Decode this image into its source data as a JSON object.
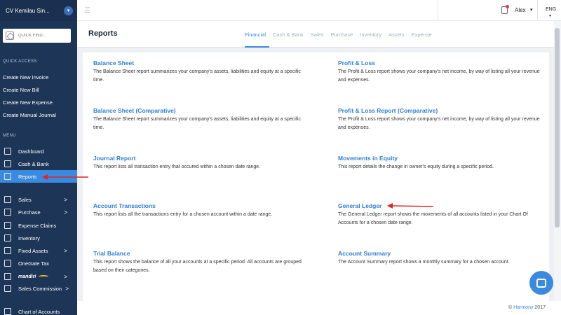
{
  "company": "CV Kemilau Sin...",
  "quick_find_placeholder": "QUICK FIND...",
  "quick_access_label": "QUICK ACCESS",
  "quick_access": [
    "Create New Invoice",
    "Create New Bill",
    "Create New Expense",
    "Create Manual Journal"
  ],
  "menu_label": "MENU",
  "menu": [
    {
      "label": "Dashboard",
      "icon": "dashboard-icon"
    },
    {
      "label": "Cash & Bank",
      "icon": "bank-icon"
    },
    {
      "label": "Reports",
      "icon": "chart-icon",
      "active": true
    },
    {
      "label": "Sales",
      "icon": "sales-icon",
      "arrow": ">"
    },
    {
      "label": "Purchase",
      "icon": "cart-icon",
      "arrow": ">"
    },
    {
      "label": "Expense Claims",
      "icon": "receipt-icon"
    },
    {
      "label": "Inventory",
      "icon": "box-icon"
    },
    {
      "label": "Fixed Assets",
      "icon": "building-icon",
      "arrow": ">"
    },
    {
      "label": "OneGate Tax",
      "icon": "tax-icon"
    },
    {
      "label": "mandiri",
      "icon": "mandiri-icon",
      "arrow": ">"
    },
    {
      "label": "Sales Commission",
      "icon": "commission-icon",
      "arrow": ">"
    },
    {
      "label": "Chart of Accounts",
      "icon": "accounts-icon"
    }
  ],
  "topbar": {
    "user": "Alex",
    "language": "ENG"
  },
  "page_title": "Reports",
  "tabs": [
    "Financial",
    "Cash & Bank",
    "Sales",
    "Purchase",
    "Inventory",
    "Assets",
    "Expense"
  ],
  "reports": [
    {
      "title": "Balance Sheet",
      "desc": "The Balance Sheet report summarizes your company's assets, liabilities and equity at a specific time."
    },
    {
      "title": "Profit & Loss",
      "desc": "The Profit & Loss report shows your company's net income, by way of listing all your revenue and expenses."
    },
    {
      "title": "Balance Sheet (Comparative)",
      "desc": "The Balance Sheet report summarizes your company's assets, liabilities and equity at a specific time."
    },
    {
      "title": "Profit & Loss Report (Comparative)",
      "desc": "The Profit & Loss report shows your company's net income, by way of listing all your revenue and expenses."
    },
    {
      "title": "Journal Report",
      "desc": "This report lists all transaction entry that occured within a chosen date range."
    },
    {
      "title": "Movements in Equity",
      "desc": "This report details the change in owner's equity during a specific period."
    },
    {
      "title": "Account Transactions",
      "desc": "This report lists all the transactions entry for a chosen account within a date range."
    },
    {
      "title": "General Ledger",
      "desc": "The General Ledger report shows the movements of all accounts listed in your Chart Of Accounts for a chosen date range."
    },
    {
      "title": "Trial Balance",
      "desc": "This report shows the balance of all your accounts at a specific period. All accounts are grouped based on their categories."
    },
    {
      "title": "Account Summary",
      "desc": "The Account Summary report shows a monthly summary for a chosen account."
    }
  ],
  "footer": {
    "prefix": "© ",
    "brand": "Harmony",
    "year": " 2017"
  },
  "colors": {
    "sidebar": "#1d3557",
    "accent": "#3a8ae0",
    "annotation_arrow": "#e02424"
  }
}
